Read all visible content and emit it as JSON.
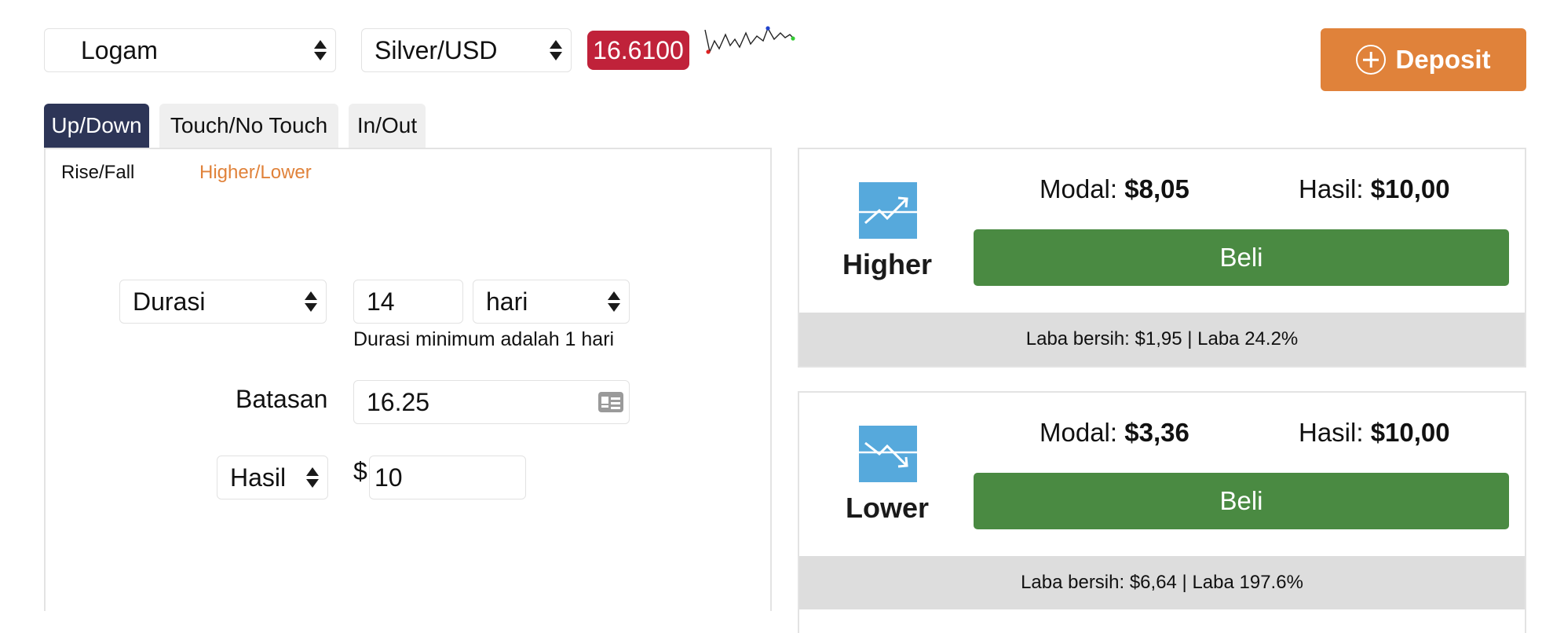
{
  "header": {
    "category_select": {
      "value": "Logam"
    },
    "asset_select": {
      "value": "Silver/USD"
    },
    "price": "16.6100",
    "deposit_label": "Deposit"
  },
  "tabs": [
    "Up/Down",
    "Touch/No Touch",
    "In/Out"
  ],
  "subtabs": [
    "Rise/Fall",
    "Higher/Lower"
  ],
  "form": {
    "duration_select": "Durasi",
    "duration_value": "14",
    "duration_unit": "hari",
    "duration_hint": "Durasi minimum adalah 1 hari",
    "barrier_label": "Batasan",
    "barrier_value": "16.25",
    "payout_select": "Hasil",
    "currency_symbol": "$",
    "payout_value": "10"
  },
  "contracts": [
    {
      "direction": "Higher",
      "stake_label": "Modal:",
      "stake_value": "$8,05",
      "payout_label": "Hasil:",
      "payout_value": "$10,00",
      "buy_label": "Beli",
      "net_profit": "Laba bersih: $1,95 | Laba 24.2%"
    },
    {
      "direction": "Lower",
      "stake_label": "Modal:",
      "stake_value": "$3,36",
      "payout_label": "Hasil:",
      "payout_value": "$10,00",
      "buy_label": "Beli",
      "net_profit": "Laba bersih: $6,64 | Laba 197.6%"
    }
  ],
  "colors": {
    "accent": "#e0823a",
    "price_badge": "#c0223a",
    "active_tab": "#2d3557",
    "buy": "#4a8a42",
    "direction_icon": "#56a9dc"
  }
}
